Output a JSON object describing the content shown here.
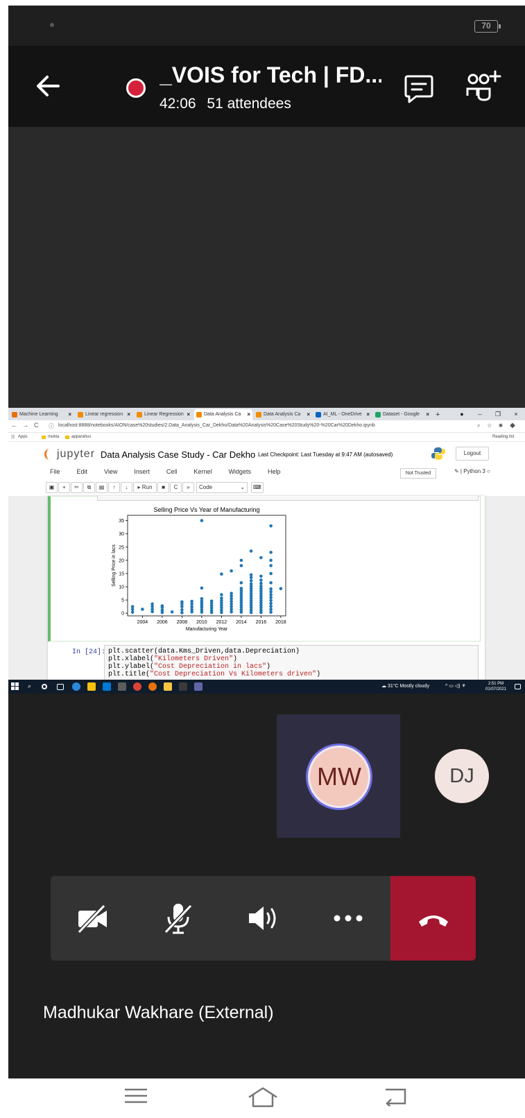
{
  "status_bar": {
    "battery": "70"
  },
  "call": {
    "title": "_VOIS for Tech | FD...",
    "duration": "42:06",
    "attendees": "51 attendees",
    "icons": {
      "back": "arrow-left-icon",
      "recording": "recording-dot-icon",
      "chat": "chat-icon",
      "participants": "add-participants-icon"
    }
  },
  "shared_screen": {
    "browser": {
      "tabs": [
        {
          "label": "Machine Learning",
          "icon_color": "#e8710a"
        },
        {
          "label": "Linear regression",
          "icon_color": "#f28b00"
        },
        {
          "label": "Linear Regression",
          "icon_color": "#f28b00"
        },
        {
          "label": "Data Analysis Ca",
          "icon_color": "#f28b00",
          "active": true
        },
        {
          "label": "Data Analysis Ca",
          "icon_color": "#f28b00"
        },
        {
          "label": "AI_ML - OneDrive",
          "icon_color": "#0a64c4"
        },
        {
          "label": "Dataset - Google",
          "icon_color": "#1fa463"
        }
      ],
      "new_tab": "+",
      "url": "localhost:8888/notebooks/AION/case%20studies/2.Data_Analysis_Car_Dekho/Data%20Analysis%20Case%20Study%20-%20Car%20Dekho.ipynb",
      "bookmarks": [
        "Apps",
        "mukta",
        "apparahus"
      ],
      "reading_list": "Reading list"
    },
    "jupyter": {
      "logo": "jupyter",
      "notebook_title": "Data Analysis Case Study - Car Dekho",
      "checkpoint": "Last Checkpoint: Last Tuesday at 9:47 AM  (autosaved)",
      "logout": "Logout",
      "menu": [
        "File",
        "Edit",
        "View",
        "Insert",
        "Cell",
        "Kernel",
        "Widgets",
        "Help"
      ],
      "trusted": "Not Trusted",
      "kernel": "Python 3",
      "toolbar": {
        "run": "Run",
        "cell_type": "Code"
      },
      "prompt": "In [24]:",
      "code_lines": [
        [
          "plt.scatter(data.Kms_Driven,data.Depreciation)",
          ""
        ],
        [
          "plt.xlabel(",
          "\"Kilometers Driven\"",
          ")"
        ],
        [
          "plt.ylabel(",
          "\"Cost Depreciation in lacs\"",
          ")"
        ],
        [
          "plt.title(",
          "\"Cost Depreciation Vs Kilometers driven\"",
          ")"
        ]
      ]
    },
    "taskbar": {
      "weather": "31°C  Mostly cloudy",
      "time": "2:51 PM",
      "date": "01/07/2021"
    }
  },
  "chart_data": {
    "type": "scatter",
    "title": "Selling Price Vs Year of Manufacturing",
    "xlabel": "Manufacturing Year",
    "ylabel": "Selling Price in lacs",
    "xlim": [
      2002.5,
      2018.5
    ],
    "ylim": [
      -1,
      37
    ],
    "xticks": [
      2004,
      2006,
      2008,
      2010,
      2012,
      2014,
      2016,
      2018
    ],
    "yticks": [
      0,
      5,
      10,
      15,
      20,
      25,
      30,
      35
    ],
    "color": "#1f77b4",
    "points": [
      [
        2003,
        0.4
      ],
      [
        2003,
        1.5
      ],
      [
        2003,
        2.5
      ],
      [
        2004,
        1.5
      ],
      [
        2005,
        0.6
      ],
      [
        2005,
        1.5
      ],
      [
        2005,
        2.5
      ],
      [
        2005,
        3.5
      ],
      [
        2006,
        0.3
      ],
      [
        2006,
        1.2
      ],
      [
        2006,
        2.2
      ],
      [
        2006,
        2.8
      ],
      [
        2007,
        0.5
      ],
      [
        2008,
        0.2
      ],
      [
        2008,
        1.3
      ],
      [
        2008,
        2.5
      ],
      [
        2008,
        3.5
      ],
      [
        2008,
        4.3
      ],
      [
        2009,
        0.5
      ],
      [
        2009,
        1.4
      ],
      [
        2009,
        2.4
      ],
      [
        2009,
        3.5
      ],
      [
        2009,
        4.5
      ],
      [
        2010,
        0.4
      ],
      [
        2010,
        1.3
      ],
      [
        2010,
        2.2
      ],
      [
        2010,
        3.0
      ],
      [
        2010,
        3.8
      ],
      [
        2010,
        4.6
      ],
      [
        2010,
        5.5
      ],
      [
        2010,
        9.5
      ],
      [
        2010,
        35
      ],
      [
        2011,
        0.3
      ],
      [
        2011,
        1.1
      ],
      [
        2011,
        2.0
      ],
      [
        2011,
        2.9
      ],
      [
        2011,
        3.8
      ],
      [
        2011,
        4.6
      ],
      [
        2012,
        0.3
      ],
      [
        2012,
        1.2
      ],
      [
        2012,
        2.1
      ],
      [
        2012,
        3.0
      ],
      [
        2012,
        3.9
      ],
      [
        2012,
        4.8
      ],
      [
        2012,
        5.7
      ],
      [
        2012,
        7.0
      ],
      [
        2012,
        14.8
      ],
      [
        2013,
        0.5
      ],
      [
        2013,
        1.5
      ],
      [
        2013,
        2.5
      ],
      [
        2013,
        3.5
      ],
      [
        2013,
        4.5
      ],
      [
        2013,
        5.5
      ],
      [
        2013,
        6.5
      ],
      [
        2013,
        7.5
      ],
      [
        2013,
        16
      ],
      [
        2014,
        0.4
      ],
      [
        2014,
        1.3
      ],
      [
        2014,
        2.2
      ],
      [
        2014,
        3.1
      ],
      [
        2014,
        4.0
      ],
      [
        2014,
        4.9
      ],
      [
        2014,
        5.8
      ],
      [
        2014,
        6.7
      ],
      [
        2014,
        7.6
      ],
      [
        2014,
        8.5
      ],
      [
        2014,
        9.4
      ],
      [
        2014,
        11.5
      ],
      [
        2014,
        18
      ],
      [
        2014,
        20
      ],
      [
        2015,
        0.3
      ],
      [
        2015,
        1.2
      ],
      [
        2015,
        2.1
      ],
      [
        2015,
        3.0
      ],
      [
        2015,
        3.9
      ],
      [
        2015,
        4.8
      ],
      [
        2015,
        5.7
      ],
      [
        2015,
        6.6
      ],
      [
        2015,
        7.5
      ],
      [
        2015,
        8.4
      ],
      [
        2015,
        9.3
      ],
      [
        2015,
        10.2
      ],
      [
        2015,
        11.1
      ],
      [
        2015,
        12.3
      ],
      [
        2015,
        13.5
      ],
      [
        2015,
        14.5
      ],
      [
        2015,
        23.5
      ],
      [
        2016,
        0.3
      ],
      [
        2016,
        1.2
      ],
      [
        2016,
        2.1
      ],
      [
        2016,
        3.0
      ],
      [
        2016,
        3.9
      ],
      [
        2016,
        4.8
      ],
      [
        2016,
        5.7
      ],
      [
        2016,
        6.6
      ],
      [
        2016,
        7.5
      ],
      [
        2016,
        8.4
      ],
      [
        2016,
        9.3
      ],
      [
        2016,
        10.2
      ],
      [
        2016,
        11.3
      ],
      [
        2016,
        12.5
      ],
      [
        2016,
        14.0
      ],
      [
        2016,
        21
      ],
      [
        2017,
        0.4
      ],
      [
        2017,
        1.5
      ],
      [
        2017,
        2.6
      ],
      [
        2017,
        3.7
      ],
      [
        2017,
        4.8
      ],
      [
        2017,
        5.9
      ],
      [
        2017,
        7.0
      ],
      [
        2017,
        8.1
      ],
      [
        2017,
        9.2
      ],
      [
        2017,
        11.5
      ],
      [
        2017,
        15
      ],
      [
        2017,
        18
      ],
      [
        2017,
        20
      ],
      [
        2017,
        23
      ],
      [
        2017,
        33
      ],
      [
        2018,
        9.3
      ]
    ]
  },
  "participants": [
    {
      "initials": "MW",
      "active": true
    },
    {
      "initials": "DJ"
    }
  ],
  "controls": {
    "icons": [
      "video-off-icon",
      "mic-off-icon",
      "speaker-icon",
      "more-icon",
      "hang-up-icon"
    ]
  },
  "speaker_name": "Madhukar Wakhare (External)",
  "colors": {
    "background": "#1f1f1f",
    "header": "#131313",
    "accent": "#6f6ee0",
    "hangup": "#a4152f",
    "recording": "#d6213a"
  }
}
